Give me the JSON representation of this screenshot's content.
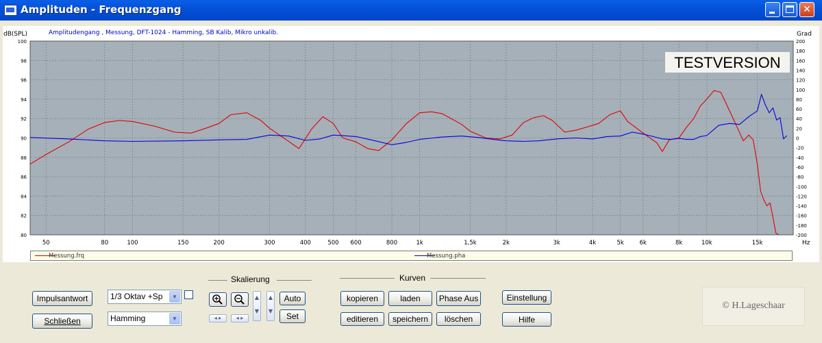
{
  "window": {
    "title": "Amplituden - Frequenzgang"
  },
  "chart_data": {
    "type": "line",
    "subtitle": "Amplitudengang , Messung, DFT-1024 - Hamming, SB Kalib, Mikro unkalib.",
    "ylabel_left": "dB(SPL)",
    "ylabel_right": "Grad",
    "xlabel": "Hz",
    "watermark": "TESTVERSION",
    "x_scale": "log",
    "xlim": [
      44,
      20000
    ],
    "ylim_left": [
      80,
      100
    ],
    "ylim_right": [
      -200,
      200
    ],
    "grid": true,
    "background": "#A6B0B8",
    "x_ticks": [
      {
        "label": "50",
        "value": 50
      },
      {
        "label": "80",
        "value": 80
      },
      {
        "label": "100",
        "value": 100
      },
      {
        "label": "150",
        "value": 150
      },
      {
        "label": "200",
        "value": 200
      },
      {
        "label": "300",
        "value": 300
      },
      {
        "label": "400",
        "value": 400
      },
      {
        "label": "500",
        "value": 500
      },
      {
        "label": "600",
        "value": 600
      },
      {
        "label": "800",
        "value": 800
      },
      {
        "label": "1k",
        "value": 1000
      },
      {
        "label": "1,5k",
        "value": 1500
      },
      {
        "label": "2k",
        "value": 2000
      },
      {
        "label": "3k",
        "value": 3000
      },
      {
        "label": "4k",
        "value": 4000
      },
      {
        "label": "5k",
        "value": 5000
      },
      {
        "label": "6k",
        "value": 6000
      },
      {
        "label": "8k",
        "value": 8000
      },
      {
        "label": "10k",
        "value": 10000
      },
      {
        "label": "15k",
        "value": 15000
      }
    ],
    "y_ticks_left": [
      "100",
      "98",
      "96",
      "94",
      "92",
      "90",
      "88",
      "86",
      "84",
      "82",
      "80"
    ],
    "y_ticks_right": [
      "200",
      "180",
      "160",
      "140",
      "120",
      "100",
      "80",
      "60",
      "40",
      "20",
      "0",
      "-20",
      "-40",
      "-60",
      "-80",
      "-100",
      "-120",
      "-140",
      "-160",
      "-180",
      "-200"
    ],
    "series": [
      {
        "name": "Messung.frq",
        "color": "#E00000",
        "axis": "left",
        "points": [
          [
            44,
            87.3
          ],
          [
            50,
            88.3
          ],
          [
            60,
            89.6
          ],
          [
            70,
            90.9
          ],
          [
            80,
            91.6
          ],
          [
            90,
            91.8
          ],
          [
            100,
            91.7
          ],
          [
            120,
            91.2
          ],
          [
            140,
            90.6
          ],
          [
            160,
            90.5
          ],
          [
            180,
            91.0
          ],
          [
            200,
            91.5
          ],
          [
            220,
            92.4
          ],
          [
            250,
            92.6
          ],
          [
            280,
            91.8
          ],
          [
            300,
            91.0
          ],
          [
            340,
            89.9
          ],
          [
            380,
            88.9
          ],
          [
            420,
            90.9
          ],
          [
            460,
            92.2
          ],
          [
            500,
            91.5
          ],
          [
            540,
            90.0
          ],
          [
            600,
            89.6
          ],
          [
            660,
            88.9
          ],
          [
            720,
            88.7
          ],
          [
            800,
            89.8
          ],
          [
            900,
            91.5
          ],
          [
            1000,
            92.6
          ],
          [
            1100,
            92.7
          ],
          [
            1200,
            92.5
          ],
          [
            1400,
            91.4
          ],
          [
            1500,
            90.7
          ],
          [
            1700,
            90.0
          ],
          [
            1900,
            89.9
          ],
          [
            2100,
            90.3
          ],
          [
            2300,
            91.6
          ],
          [
            2500,
            92.1
          ],
          [
            2700,
            92.3
          ],
          [
            2900,
            91.8
          ],
          [
            3200,
            90.6
          ],
          [
            3500,
            90.8
          ],
          [
            3800,
            91.1
          ],
          [
            4200,
            91.5
          ],
          [
            4600,
            92.4
          ],
          [
            5000,
            92.8
          ],
          [
            5300,
            91.7
          ],
          [
            5700,
            91.0
          ],
          [
            6200,
            90.2
          ],
          [
            6700,
            89.5
          ],
          [
            7000,
            88.6
          ],
          [
            7400,
            89.8
          ],
          [
            8000,
            90.0
          ],
          [
            8500,
            91.1
          ],
          [
            9000,
            92.0
          ],
          [
            9500,
            93.3
          ],
          [
            10000,
            94.0
          ],
          [
            10600,
            94.9
          ],
          [
            11200,
            94.7
          ],
          [
            12000,
            92.8
          ],
          [
            12800,
            91.0
          ],
          [
            13400,
            89.7
          ],
          [
            14000,
            90.3
          ],
          [
            14500,
            89.8
          ],
          [
            15000,
            87.3
          ],
          [
            15400,
            84.5
          ],
          [
            15800,
            83.6
          ],
          [
            16200,
            83.0
          ],
          [
            16600,
            83.3
          ],
          [
            17000,
            81.8
          ],
          [
            17400,
            80.2
          ],
          [
            17800,
            80.0
          ]
        ]
      },
      {
        "name": "Messung.pha",
        "color": "#0000E0",
        "axis": "right",
        "points": [
          [
            44,
            1
          ],
          [
            60,
            -2
          ],
          [
            80,
            -6
          ],
          [
            100,
            -7
          ],
          [
            150,
            -6
          ],
          [
            200,
            -4
          ],
          [
            250,
            -3
          ],
          [
            300,
            6
          ],
          [
            350,
            4
          ],
          [
            400,
            -5
          ],
          [
            450,
            -2
          ],
          [
            500,
            6
          ],
          [
            600,
            3
          ],
          [
            700,
            -6
          ],
          [
            800,
            -14
          ],
          [
            900,
            -9
          ],
          [
            1000,
            -3
          ],
          [
            1200,
            2
          ],
          [
            1400,
            4
          ],
          [
            1600,
            1
          ],
          [
            1800,
            -3
          ],
          [
            2000,
            -6
          ],
          [
            2300,
            -7
          ],
          [
            2600,
            -6
          ],
          [
            3000,
            -2
          ],
          [
            3500,
            0
          ],
          [
            4000,
            -2
          ],
          [
            4500,
            3
          ],
          [
            5000,
            4
          ],
          [
            5500,
            12
          ],
          [
            6000,
            8
          ],
          [
            6500,
            3
          ],
          [
            7000,
            -2
          ],
          [
            7500,
            -3
          ],
          [
            8000,
            -1
          ],
          [
            8500,
            -3
          ],
          [
            9000,
            -3
          ],
          [
            9500,
            3
          ],
          [
            10000,
            5
          ],
          [
            11000,
            26
          ],
          [
            12000,
            30
          ],
          [
            13000,
            28
          ],
          [
            14000,
            44
          ],
          [
            15000,
            56
          ],
          [
            15500,
            90
          ],
          [
            16000,
            68
          ],
          [
            16500,
            52
          ],
          [
            17000,
            62
          ],
          [
            17500,
            37
          ],
          [
            18000,
            42
          ],
          [
            18500,
            -2
          ],
          [
            19000,
            5
          ]
        ]
      }
    ],
    "legend": [
      {
        "name": "Messung.frq",
        "color": "#E00000"
      },
      {
        "name": "Messung.pha",
        "color": "#0000E0"
      }
    ]
  },
  "controls": {
    "impulse_label": "Impulsantwort",
    "close_label": "Schließen",
    "octave_select": "1/3 Oktav +Sp",
    "window_select": "Hamming",
    "scaling_title": "Skalierung",
    "auto_label": "Auto",
    "set_label": "Set",
    "curves_title": "Kurven",
    "copy_label": "kopieren",
    "load_label": "laden",
    "phase_label": "Phase Aus",
    "edit_label": "editieren",
    "save_label": "speichern",
    "delete_label": "löschen",
    "settings_label": "Einstellung",
    "help_label": "Hilfe"
  },
  "copyright": "© H.Lageschaar"
}
